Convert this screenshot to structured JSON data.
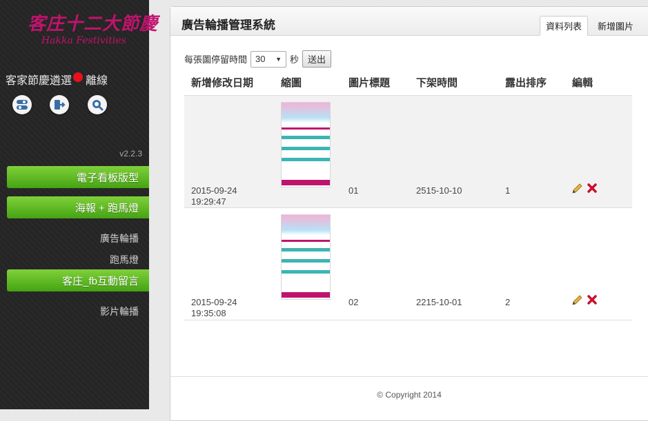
{
  "sidebar": {
    "logo_text": "客庄十二大節慶",
    "logo_subtitle": "Hakka Festivities",
    "site_name": "客家節慶遴選",
    "status": "離線",
    "status_color": "#e8101a",
    "icons": [
      "settings-icon",
      "logout-icon",
      "search-icon"
    ],
    "version": "v2.2.3",
    "menu": [
      {
        "label": "電子看板版型"
      },
      {
        "label": "海報 + 跑馬燈"
      },
      {
        "label": "廣告輪播"
      },
      {
        "label": "跑馬燈"
      },
      {
        "label": "客庄_fb互動留言"
      },
      {
        "label": "影片輪播"
      }
    ]
  },
  "panel": {
    "title": "廣告輪播管理系統",
    "tabs": [
      {
        "label": "資料列表",
        "active": true
      },
      {
        "label": "新增圖片",
        "active": false
      }
    ]
  },
  "controls": {
    "interval_label": "每張圖停留時間",
    "interval_value": "30",
    "unit": "秒",
    "submit_label": "送出"
  },
  "table": {
    "columns": [
      "新增修改日期",
      "縮圖",
      "圖片標題",
      "下架時間",
      "露出排序",
      "編輯"
    ],
    "rows": [
      {
        "date": "2015-09-24",
        "time": "19:29:47",
        "title": "01",
        "expire": "2515-10-10",
        "order": "1"
      },
      {
        "date": "2015-09-24",
        "time": "19:35:08",
        "title": "02",
        "expire": "2215-10-01",
        "order": "2"
      }
    ]
  },
  "footer": {
    "copyright": "© Copyright 2014"
  },
  "colors": {
    "accent_green": "#5cb82a",
    "logo_magenta": "#c0136d",
    "delete_red": "#c8102e"
  }
}
